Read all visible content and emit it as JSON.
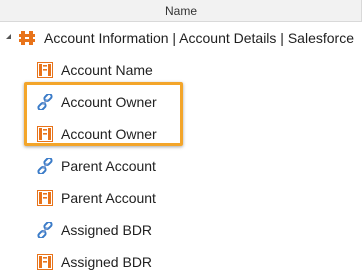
{
  "header": {
    "name_label": "Name"
  },
  "tree": {
    "root": {
      "label": "Account Information | Account Details | Salesforce",
      "icon": "component-icon"
    },
    "items": [
      {
        "label": "Account Name",
        "icon": "field-text-icon"
      },
      {
        "label": "Account Owner",
        "icon": "link-icon"
      },
      {
        "label": "Account Owner",
        "icon": "field-text-icon"
      },
      {
        "label": "Parent Account",
        "icon": "link-icon"
      },
      {
        "label": "Parent Account",
        "icon": "field-text-icon"
      },
      {
        "label": "Assigned BDR",
        "icon": "link-icon"
      },
      {
        "label": "Assigned BDR",
        "icon": "field-text-icon"
      }
    ]
  },
  "colors": {
    "accent": "#f3a52a",
    "field_icon": "#e8731a",
    "link_icon": "#3a7bc8"
  }
}
